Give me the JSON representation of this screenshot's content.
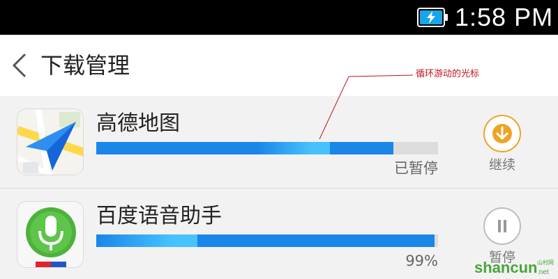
{
  "status_bar": {
    "time": "1:58 PM",
    "battery_state": "charging",
    "battery_color": "#19a6e8"
  },
  "header": {
    "back_icon": "chevron-left-icon",
    "title": "下载管理"
  },
  "annotation": {
    "text": "循环游动的光标",
    "color": "#c0111d"
  },
  "downloads": [
    {
      "name": "高德地图",
      "icon": "amap-icon",
      "progress_percent": 87,
      "status": "已暂停",
      "action_icon": "download-arrow-icon",
      "action_label": "继续",
      "action_color": "#f2a223"
    },
    {
      "name": "百度语音助手",
      "icon": "baidu-voice-icon",
      "progress_percent": 99,
      "status": "99%",
      "action_icon": "pause-icon",
      "action_label": "暂停"
    }
  ],
  "watermark": {
    "text": "shancun",
    "suffix": ".net",
    "tag": "山村网"
  },
  "colors": {
    "progress": "#1a86e8",
    "progress_shine": "#48c1ff",
    "track": "#dcdcdc"
  }
}
